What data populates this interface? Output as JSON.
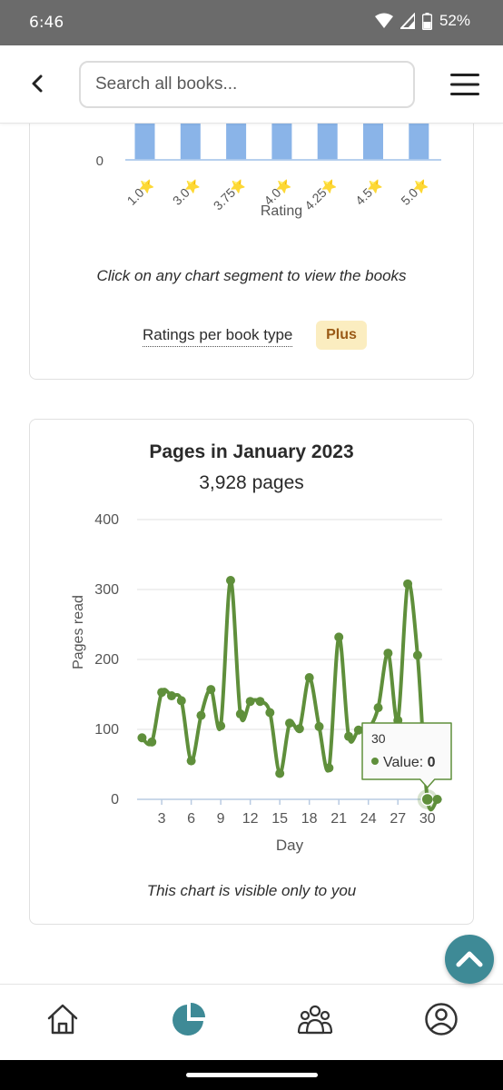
{
  "status_bar": {
    "time": "6:46",
    "battery": "52%"
  },
  "header": {
    "search_placeholder": "Search all books..."
  },
  "ratings_card": {
    "axis_zero": "0",
    "star_glyph": "⭐",
    "xlabel": "Rating",
    "note": "Click on any chart segment to view the books",
    "link_label": "Ratings per book type",
    "badge": "Plus"
  },
  "pages_card": {
    "title": "Pages in January 2023",
    "subtitle": "3,928 pages",
    "note": "This chart is visible only to you"
  },
  "chart_data": [
    {
      "type": "bar",
      "categories": [
        "1.0",
        "3.0",
        "3.75",
        "4.0",
        "4.25",
        "4.5",
        "5.0"
      ],
      "xlabel": "Rating",
      "ylabel": "",
      "bar_color": "#8ab4e8",
      "y_ticks_visible": [
        "0"
      ]
    },
    {
      "type": "line",
      "title": "Pages in January 2023",
      "subtitle": "3,928 pages",
      "xlabel": "Day",
      "ylabel": "Pages read",
      "ylim": [
        0,
        400
      ],
      "y_ticks": [
        0,
        100,
        200,
        300,
        400
      ],
      "x_ticks": [
        3,
        6,
        9,
        12,
        15,
        18,
        21,
        24,
        27,
        30
      ],
      "x": [
        1,
        2,
        3,
        4,
        5,
        6,
        7,
        8,
        9,
        10,
        11,
        12,
        13,
        14,
        15,
        16,
        17,
        18,
        19,
        20,
        21,
        22,
        23,
        24,
        25,
        26,
        27,
        28,
        29,
        30,
        31
      ],
      "values": [
        88,
        82,
        153,
        148,
        141,
        55,
        120,
        157,
        105,
        313,
        122,
        140,
        140,
        124,
        37,
        109,
        101,
        174,
        104,
        45,
        232,
        90,
        99,
        101,
        131,
        209,
        113,
        308,
        206,
        0,
        0
      ],
      "line_color": "#5f8f3b",
      "grid": true,
      "tooltip": {
        "title": "30",
        "label": "Value:",
        "value": "0"
      }
    }
  ]
}
